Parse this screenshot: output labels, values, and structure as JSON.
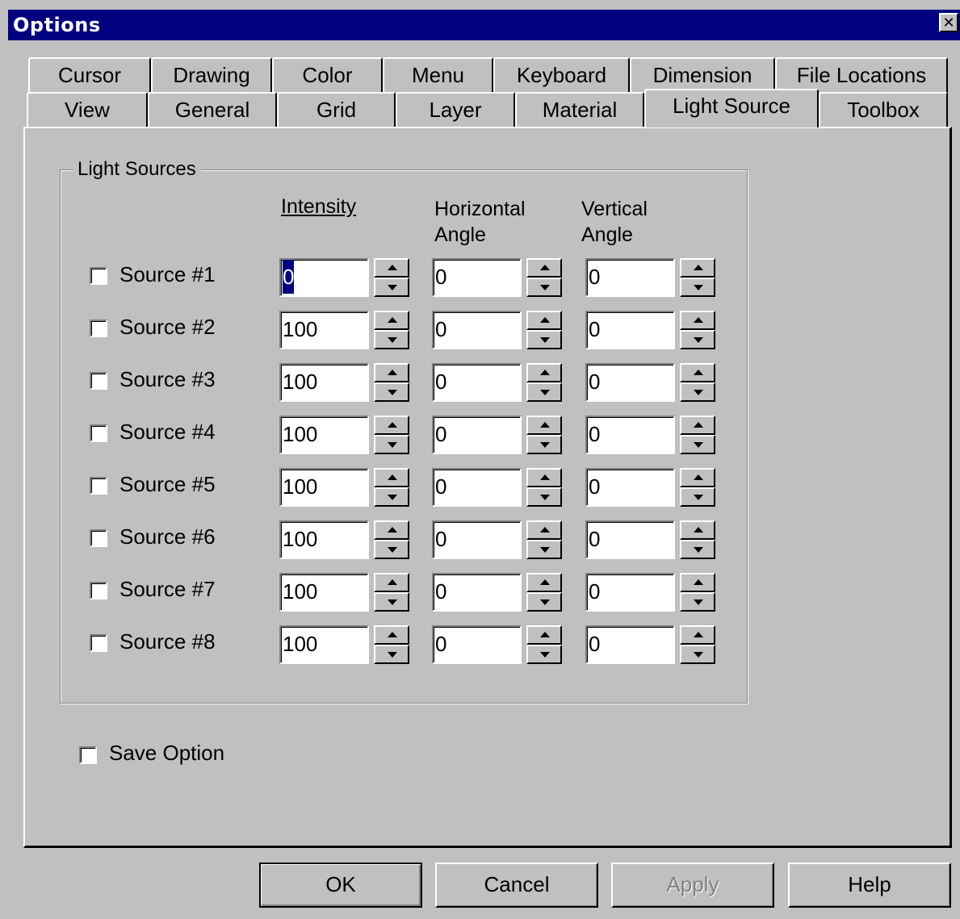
{
  "window": {
    "title": "Options",
    "close_glyph": "✕"
  },
  "tabs_row_back": [
    "Cursor",
    "Drawing",
    "Color",
    "Menu",
    "Keyboard",
    "Dimension",
    "File Locations"
  ],
  "tabs_row_front": [
    "View",
    "General",
    "Grid",
    "Layer",
    "Material",
    "Light Source",
    "Toolbox"
  ],
  "active_tab": "Light Source",
  "group": {
    "label": "Light Sources",
    "headers": {
      "intensity": "Intensity",
      "horizontal_line1": "Horizontal",
      "horizontal_line2": "Angle",
      "vertical_line1": "Vertical",
      "vertical_line2": "Angle"
    },
    "sources": [
      {
        "label": "Source #1",
        "checked": false,
        "intensity": "0",
        "horizontal": "0",
        "vertical": "0",
        "intensity_selected": true
      },
      {
        "label": "Source #2",
        "checked": false,
        "intensity": "100",
        "horizontal": "0",
        "vertical": "0"
      },
      {
        "label": "Source #3",
        "checked": false,
        "intensity": "100",
        "horizontal": "0",
        "vertical": "0"
      },
      {
        "label": "Source #4",
        "checked": false,
        "intensity": "100",
        "horizontal": "0",
        "vertical": "0"
      },
      {
        "label": "Source #5",
        "checked": false,
        "intensity": "100",
        "horizontal": "0",
        "vertical": "0"
      },
      {
        "label": "Source #6",
        "checked": false,
        "intensity": "100",
        "horizontal": "0",
        "vertical": "0"
      },
      {
        "label": "Source #7",
        "checked": false,
        "intensity": "100",
        "horizontal": "0",
        "vertical": "0"
      },
      {
        "label": "Source #8",
        "checked": false,
        "intensity": "100",
        "horizontal": "0",
        "vertical": "0"
      }
    ]
  },
  "save_option": {
    "label": "Save Option",
    "checked": false
  },
  "buttons": {
    "ok": "OK",
    "cancel": "Cancel",
    "apply": "Apply",
    "help": "Help"
  },
  "colors": {
    "titlebar": "#000080",
    "face": "#c0c0c0",
    "selection": "#000080"
  }
}
